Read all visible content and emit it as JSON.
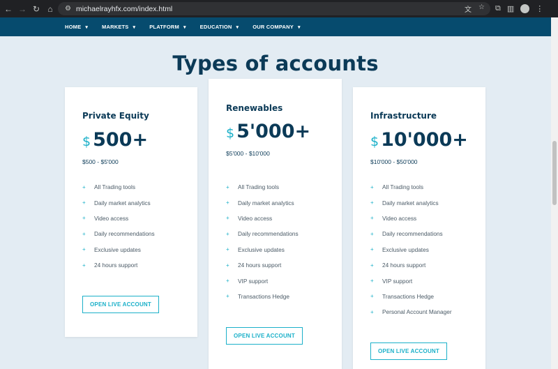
{
  "browser": {
    "url": "michaelrayhfx.com/index.html"
  },
  "nav": {
    "items": [
      {
        "label": "HOME"
      },
      {
        "label": "MARKETS"
      },
      {
        "label": "PLATFORM"
      },
      {
        "label": "EDUCATION"
      },
      {
        "label": "OUR COMPANY"
      }
    ]
  },
  "heading": "Types of accounts",
  "cards": [
    {
      "title": "Private Equity",
      "currency": "$",
      "amount": "500+",
      "range": "$500 - $5'000",
      "features": [
        "All Trading tools",
        "Daily market analytics",
        "Video access",
        "Daily recommendations",
        "Exclusive updates",
        "24 hours support"
      ],
      "cta": "OPEN LIVE ACCOUNT"
    },
    {
      "title": "Renewables",
      "currency": "$",
      "amount": "5'000+",
      "range": "$5'000 - $10'000",
      "features": [
        "All Trading tools",
        "Daily market analytics",
        "Video access",
        "Daily recommendations",
        "Exclusive updates",
        "24 hours support",
        "VIP support",
        "Transactions Hedge"
      ],
      "cta": "OPEN LIVE ACCOUNT"
    },
    {
      "title": "Infrastructure",
      "currency": "$",
      "amount": "10'000+",
      "range": "$10'000 - $50'000",
      "features": [
        "All Trading tools",
        "Daily market analytics",
        "Video access",
        "Daily recommendations",
        "Exclusive updates",
        "24 hours support",
        "VIP support",
        "Transactions Hedge",
        "Personal Account Manager"
      ],
      "cta": "OPEN LIVE ACCOUNT"
    }
  ],
  "colors": {
    "nav_bg": "#064b6e",
    "heading": "#0b3a57",
    "accent": "#1bb0c9",
    "page_bg": "#e3ecf3"
  }
}
